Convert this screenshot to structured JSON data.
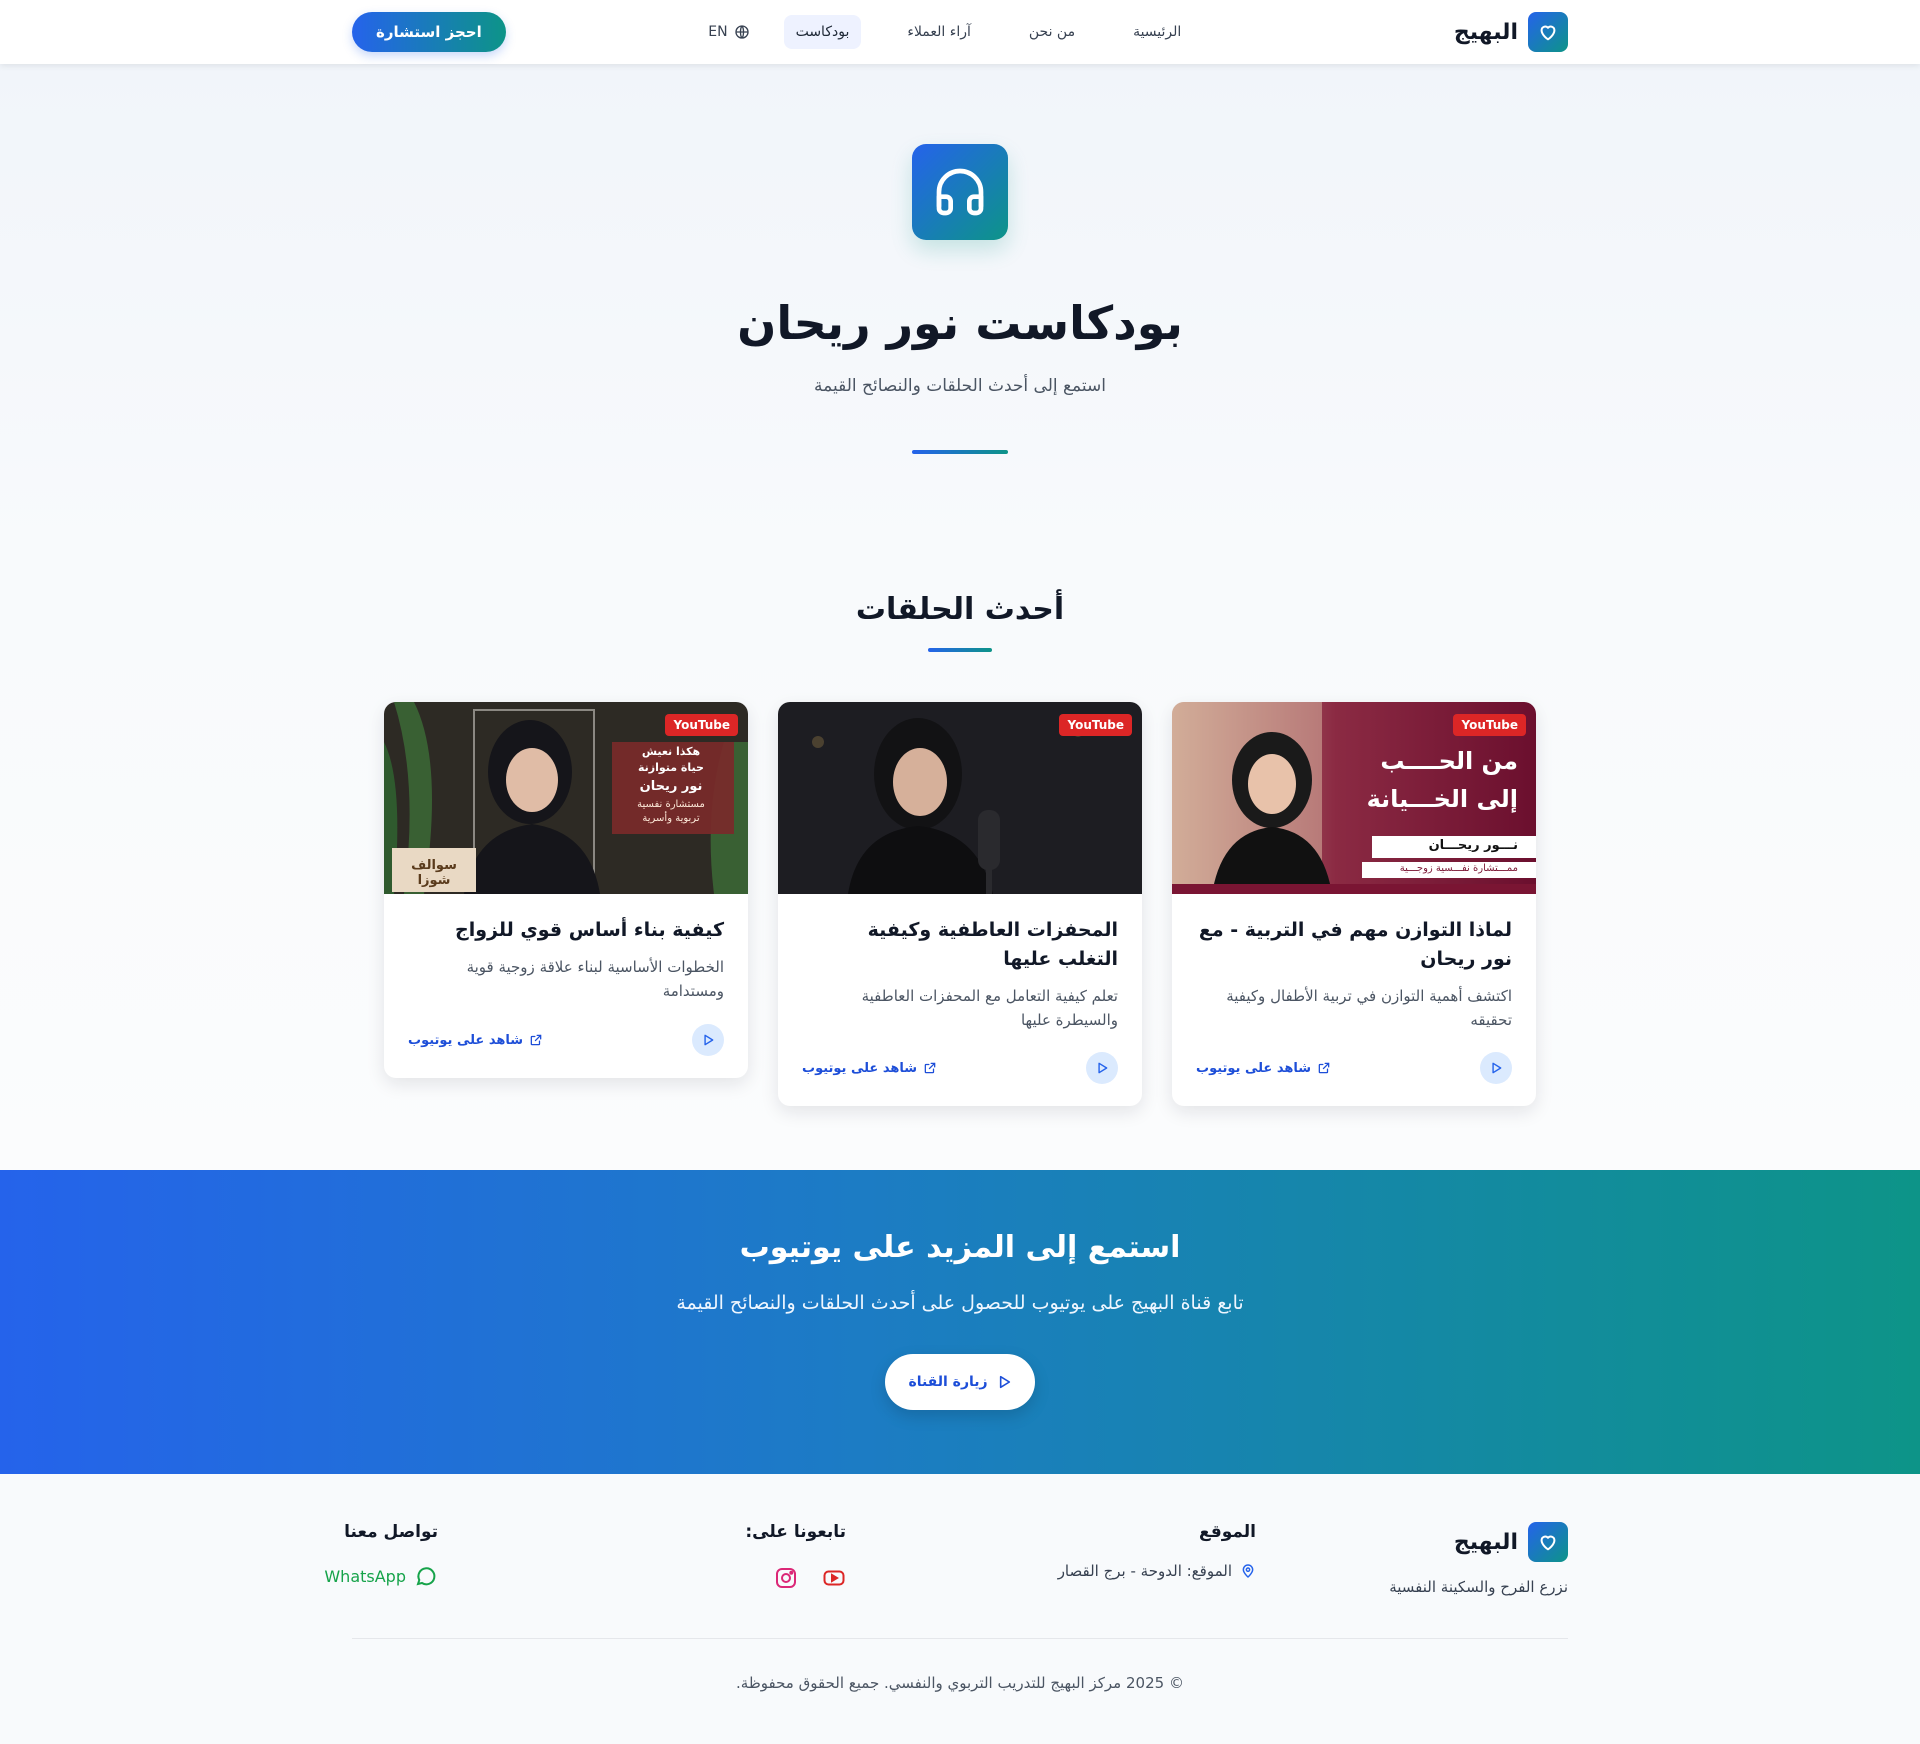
{
  "header": {
    "brand": "البهيج",
    "nav": [
      "الرئيسية",
      "من نحن",
      "آراء العملاء",
      "بودكاست"
    ],
    "lang": "EN",
    "cta": "احجز استشارة"
  },
  "hero": {
    "title": "بودكاست نور ريحان",
    "subtitle": "استمع إلى أحدث الحلقات والنصائح القيمة"
  },
  "episodes": {
    "section_title": "أحدث الحلقات",
    "badge": "YouTube",
    "watch_label": "شاهد على يوتيوب",
    "items": [
      {
        "title": "لماذا التوازن مهم في التربية - مع نور ريحان",
        "desc": "اكتشف أهمية التوازن في تربية الأطفال وكيفية تحقيقه",
        "thumb_lines": [
          "من الحــــب",
          "إلى الخـــيانة",
          "نـــور ريحـــان",
          "ممـــتشارة نفـــسية زوجـــية"
        ]
      },
      {
        "title": "المحفزات العاطفية وكيفية التغلب عليها",
        "desc": "تعلم كيفية التعامل مع المحفزات العاطفية والسيطرة عليها",
        "thumb_lines": []
      },
      {
        "title": "كيفية بناء أساس قوي للزواج",
        "desc": "الخطوات الأساسية لبناء علاقة زوجية قوية ومستدامة",
        "thumb_lines": [
          "هكذا نعيش",
          "حياة متوازنة",
          "نور ريحان",
          "مستشارة نفسية",
          "تربوية وأسرية",
          "سوالف شوزا"
        ]
      }
    ]
  },
  "band": {
    "title": "استمع إلى المزيد على يوتيوب",
    "subtitle": "تابع قناة البهيج على يوتيوب للحصول على أحدث الحلقات والنصائح القيمة",
    "button": "زيارة القناة"
  },
  "footer": {
    "brand": "البهيج",
    "tagline": "نزرع الفرح والسكينة النفسية",
    "location_head": "الموقع",
    "location": "الموقع: الدوحة - برج القصار",
    "follow_head": "تابعونا على:",
    "contact_head": "تواصل معنا",
    "whatsapp": "WhatsApp",
    "copyright": "© 2025 مركز البهيج للتدريب التربوي والنفسي. جميع الحقوق محفوظة."
  },
  "colors": {
    "primary": "#2563eb",
    "teal": "#0d9488",
    "youtube": "#dc2626",
    "whatsapp": "#16a34a",
    "instagram": "#db2777"
  }
}
